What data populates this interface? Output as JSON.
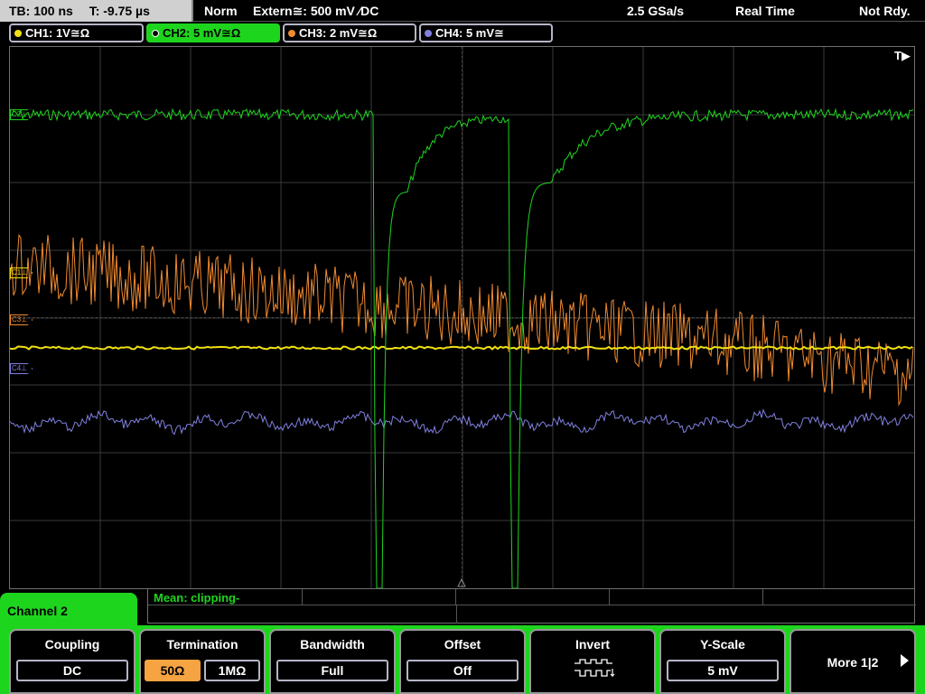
{
  "topbar": {
    "timebase": "TB: 100 ns",
    "trigger_time": "T: -9.75 µs",
    "trigger_mode": "Norm",
    "trigger_source": "Extern≅: 500 mV ⁄DC",
    "sample_rate": "2.5 GSa/s",
    "acq_mode": "Real Time",
    "status": "Not Rdy."
  },
  "channels": [
    {
      "label": "CH1: 1V≅Ω",
      "color": "#f0e010"
    },
    {
      "label": "CH2: 5 mV≅Ω",
      "color": "#1ed51e"
    },
    {
      "label": "CH3: 2 mV≅Ω",
      "color": "#f08a30"
    },
    {
      "label": "CH4: 5 mV≅",
      "color": "#8080e0"
    }
  ],
  "display": {
    "trigger_marker": "T▶",
    "markers": {
      "c1": "C1⊥",
      "c2": "C2⊥",
      "c3": "C3⊥",
      "c4": "C4⊥"
    }
  },
  "measurement": {
    "text": "Mean: clipping-"
  },
  "menu": {
    "title": "Channel 2",
    "coupling": {
      "label": "Coupling",
      "value": "DC"
    },
    "termination": {
      "label": "Termination",
      "opt1": "50Ω",
      "opt2": "1MΩ"
    },
    "bandwidth": {
      "label": "Bandwidth",
      "value": "Full"
    },
    "offset": {
      "label": "Offset",
      "value": "Off"
    },
    "invert": {
      "label": "Invert"
    },
    "yscale": {
      "label": "Y-Scale",
      "value": "5 mV"
    },
    "more": {
      "label": "More 1|2"
    }
  },
  "colors": {
    "ch1": "#f0e010",
    "ch2": "#1ed51e",
    "ch3": "#f08a30",
    "ch4": "#8080e0",
    "grid": "#3a3a3a",
    "accent": "#1ed51e",
    "selected": "#f5a441"
  }
}
